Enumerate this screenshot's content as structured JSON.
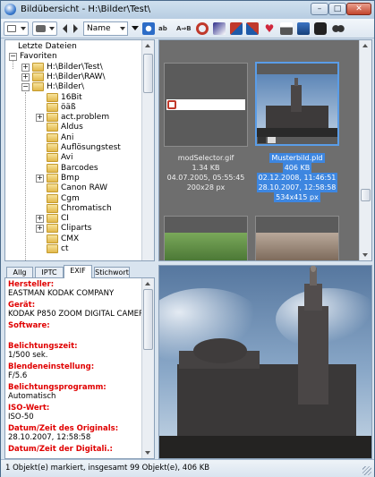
{
  "window": {
    "title": "Bildübersicht - H:\\Bilder\\Test\\",
    "min_label": "–",
    "max_label": "□",
    "close_label": "✕"
  },
  "toolbar": {
    "sort_value": "Name",
    "icons": [
      "view-mode-icon",
      "camera-icon",
      "back-arrow-icon",
      "forward-arrow-icon",
      "sort-dropdown",
      "sort-direction-icon",
      "rotate-icon",
      "rename-icon",
      "undo-icon",
      "color-icon",
      "recycle-icon",
      "shuffle-icon",
      "heart-icon",
      "print-icon",
      "mail-icon",
      "search-icon"
    ]
  },
  "tree": {
    "items": [
      {
        "label": "Letzte Dateien",
        "depth": 0
      },
      {
        "label": "Favoriten",
        "depth": 0
      },
      {
        "label": "H:\\Bilder\\Test\\",
        "depth": 1
      },
      {
        "label": "H:\\Bilder\\RAW\\",
        "depth": 1
      },
      {
        "label": "H:\\Bilder\\",
        "depth": 1
      },
      {
        "label": "16Bit",
        "depth": 2
      },
      {
        "label": "öäß",
        "depth": 2
      },
      {
        "label": "act.problem",
        "depth": 2
      },
      {
        "label": "Aldus",
        "depth": 2
      },
      {
        "label": "Ani",
        "depth": 2
      },
      {
        "label": "Auflösungstest",
        "depth": 2
      },
      {
        "label": "Avi",
        "depth": 2
      },
      {
        "label": "Barcodes",
        "depth": 2
      },
      {
        "label": "Bmp",
        "depth": 2
      },
      {
        "label": "Canon RAW",
        "depth": 2
      },
      {
        "label": "Cgm",
        "depth": 2
      },
      {
        "label": "Chromatisch",
        "depth": 2
      },
      {
        "label": "CI",
        "depth": 2
      },
      {
        "label": "Cliparts",
        "depth": 2
      },
      {
        "label": "CMX",
        "depth": 2
      },
      {
        "label": "ct",
        "depth": 2
      }
    ]
  },
  "gallery": {
    "items": [
      {
        "name": "modSelector.gif",
        "size": "1.34 KB",
        "date": "04.07.2005, 05:55:45",
        "dims": "200x28 px"
      },
      {
        "name": "Musterbild.pld",
        "size": "406 KB",
        "date": "02.12.2008, 11:46:51",
        "date2": "28.10.2007, 12:58:58",
        "dims": "534x415 px"
      }
    ]
  },
  "tabs": [
    "Allg",
    "IPTC",
    "EXIF",
    "Stichwort"
  ],
  "exif": {
    "fields": [
      {
        "label": "Hersteller:",
        "value": "EASTMAN KODAK COMPANY"
      },
      {
        "label": "Gerät:",
        "value": "KODAK P850 ZOOM DIGITAL CAMERA"
      },
      {
        "label": "Software:",
        "value": ""
      },
      {
        "label": "Belichtungszeit:",
        "value": "1/500 sek."
      },
      {
        "label": "Blendeneinstellung:",
        "value": "F/5.6"
      },
      {
        "label": "Belichtungsprogramm:",
        "value": "Automatisch"
      },
      {
        "label": "ISO-Wert:",
        "value": "ISO-50"
      },
      {
        "label": "Datum/Zeit des Originals:",
        "value": "28.10.2007, 12:58:58"
      },
      {
        "label": "Datum/Zeit der Digitali.:",
        "value": ""
      }
    ]
  },
  "status": {
    "text": "1 Objekt(e) markiert, insgesamt 99 Objekt(e), 406 KB"
  }
}
